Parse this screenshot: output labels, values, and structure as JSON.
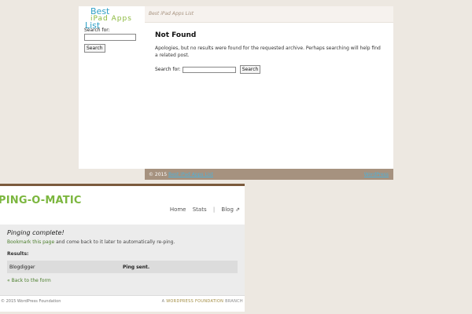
{
  "blog": {
    "title_line1": "Best",
    "title_line2": "iPad Apps",
    "title_line3": "List",
    "header_text": "Best iPad Apps List",
    "sidebar_search_label": "Search for:",
    "sidebar_search_button": "Search",
    "not_found_title": "Not Found",
    "not_found_text": "Apologies, but no results were found for the requested archive. Perhaps searching will help find a related post.",
    "main_search_label": "Search for:",
    "main_search_button": "Search",
    "footer_copy": "© 2015",
    "footer_link": "Best iPad Apps List",
    "footer_right": "WordPress"
  },
  "ping": {
    "logo": "PING-O-MATIC",
    "nav": {
      "home": "Home",
      "stats": "Stats",
      "separator": "|",
      "blog": "Blog ⇗"
    },
    "title": "Pinging complete!",
    "sub_link": "Bookmark this page",
    "sub_text": "and come back to it later to automatically re-ping.",
    "results_label": "Results:",
    "results": [
      {
        "service": "Blogdigger",
        "status": "Ping sent."
      }
    ],
    "back_link": "« Back to the form",
    "footer_left": "© 2015 WordPress Foundation",
    "footer_right_prefix": "A",
    "footer_right_brand": "WORDPRESS FOUNDATION",
    "footer_right_suffix": "BRANCH"
  }
}
